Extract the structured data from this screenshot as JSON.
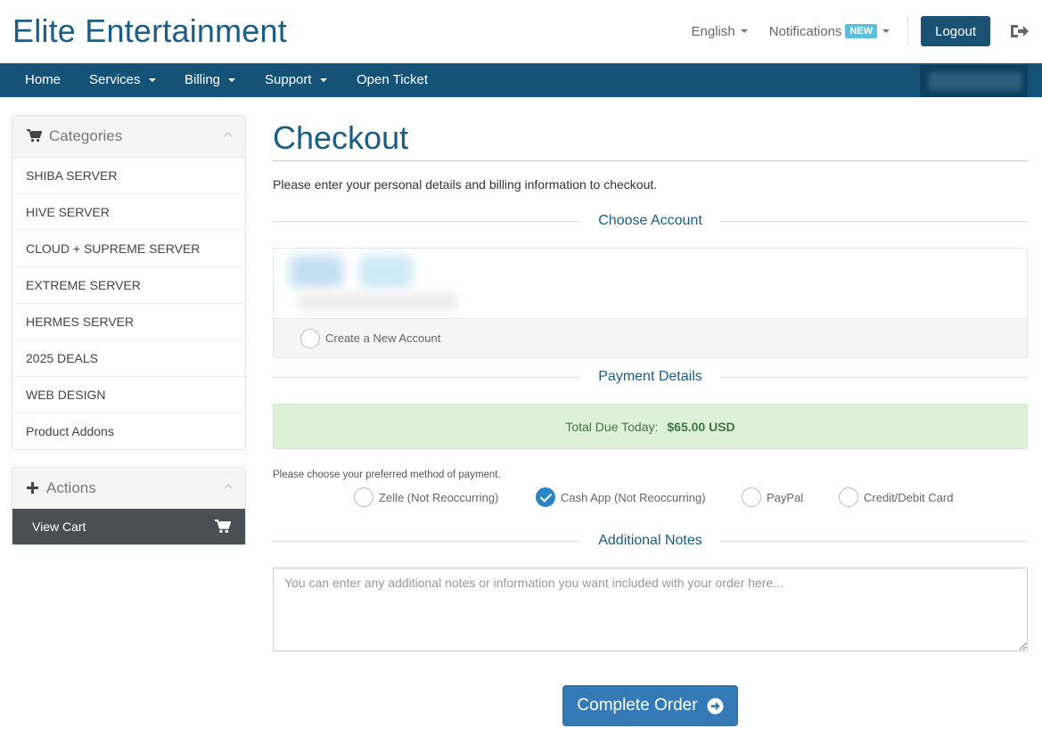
{
  "header": {
    "brand": "Elite Entertainment",
    "language": "English",
    "notifications": "Notifications",
    "new_badge": "NEW",
    "logout": "Logout"
  },
  "nav": {
    "items": [
      {
        "label": "Home"
      },
      {
        "label": "Services"
      },
      {
        "label": "Billing"
      },
      {
        "label": "Support"
      },
      {
        "label": "Open Ticket"
      }
    ]
  },
  "sidebar": {
    "categories_title": "Categories",
    "categories": [
      "SHIBA SERVER",
      "HIVE SERVER",
      "CLOUD + SUPREME SERVER",
      "EXTREME SERVER",
      "HERMES SERVER",
      "2025 DEALS",
      "WEB DESIGN",
      "Product Addons"
    ],
    "actions_title": "Actions",
    "view_cart": "View Cart"
  },
  "main": {
    "title": "Checkout",
    "intro": "Please enter your personal details and billing information to checkout.",
    "choose_account": "Choose Account",
    "create_account": "Create a New Account",
    "payment_details": "Payment Details",
    "total_label": "Total Due Today:",
    "total_value": "$65.00 USD",
    "payment_prompt": "Please choose your preferred method of payment.",
    "payment_methods": [
      {
        "label": "Zelle (Not Reoccurring)",
        "selected": false
      },
      {
        "label": "Cash App (Not Reoccurring)",
        "selected": true
      },
      {
        "label": "PayPal",
        "selected": false
      },
      {
        "label": "Credit/Debit Card",
        "selected": false
      }
    ],
    "additional_notes": "Additional Notes",
    "notes_placeholder": "You can enter any additional notes or information you want included with your order here...",
    "complete_order": "Complete Order"
  },
  "colors": {
    "brand": "#1a5d85",
    "navbar": "#155278",
    "primary_button": "#337ab7",
    "success_bg": "#dff0d8",
    "success_text": "#3c763d"
  }
}
